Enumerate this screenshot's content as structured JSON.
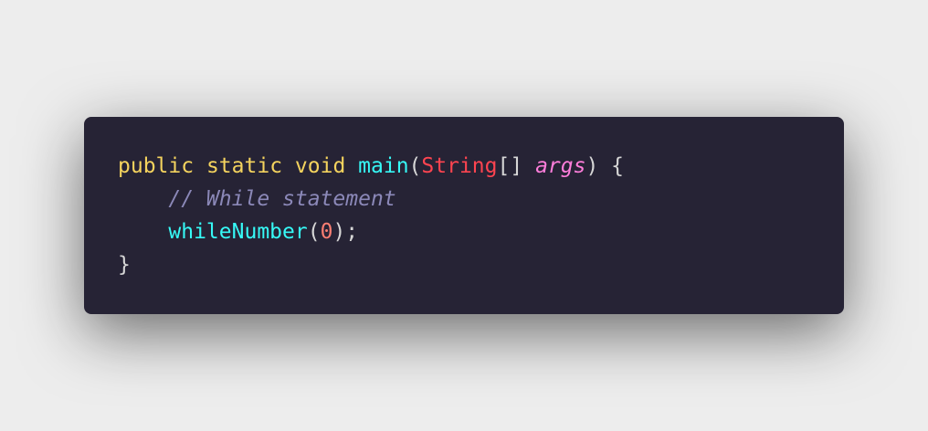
{
  "code": {
    "line1": {
      "kw1": "public",
      "kw2": "static",
      "kw3": "void",
      "fn": "main",
      "open_paren": "(",
      "type": "String",
      "brackets": "[]",
      "param": "args",
      "close": ") {"
    },
    "line2": {
      "comment": "// While statement"
    },
    "line3": {
      "fn": "whileNumber",
      "open_paren": "(",
      "num": "0",
      "close": ");"
    },
    "line4": {
      "brace": "}"
    }
  },
  "colors": {
    "background": "#262335",
    "keyword": "#f4d35e",
    "function": "#36f9f6",
    "type": "#fe4450",
    "parameter": "#ff7edb",
    "comment": "#8b88b8",
    "number": "#f97e72",
    "punctuation": "#d6d6d6"
  }
}
